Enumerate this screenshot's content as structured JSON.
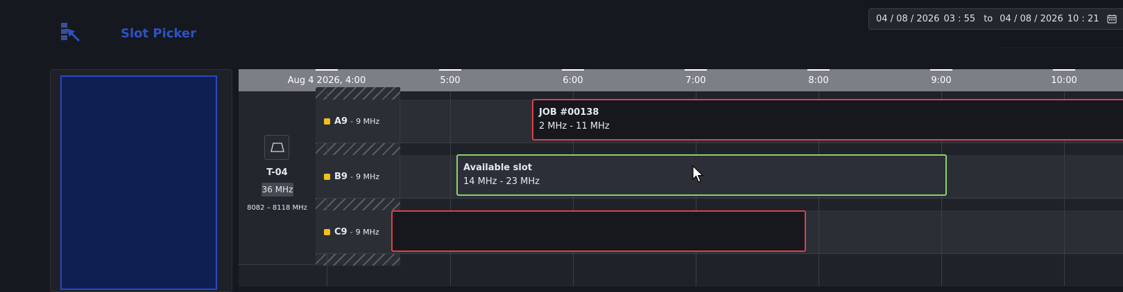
{
  "app": {
    "title": "Slot Picker",
    "logo_icon": "slot-picker-logo-icon"
  },
  "date_range": {
    "from_date": "04 / 08 / 2026",
    "from_time": "03 : 55",
    "separator": "to",
    "to_date": "04 / 08 / 2026",
    "to_time": "10 : 21",
    "icon": "calendar-icon"
  },
  "timeline": {
    "ticks": [
      "Aug 4 2026, 4:00",
      "5:00",
      "6:00",
      "7:00",
      "8:00",
      "9:00",
      "10:00"
    ]
  },
  "track": {
    "icon": "trapezoid-icon",
    "name": "T-04",
    "bandwidth": "36 MHz",
    "freq_range": "8082 – 8118 MHz"
  },
  "channels": [
    {
      "name": "A9",
      "sep": "-",
      "bandwidth": "9 MHz"
    },
    {
      "name": "B9",
      "sep": "-",
      "bandwidth": "9 MHz"
    },
    {
      "name": "C9",
      "sep": "-",
      "bandwidth": "9 MHz"
    }
  ],
  "slots": {
    "job": {
      "title": "JOB #00138",
      "range": "2 MHz - 11 MHz"
    },
    "available": {
      "title": "Available slot",
      "range": "14 MHz - 23 MHz"
    }
  },
  "colors": {
    "accent": "#2d52c2",
    "busy_border": "#e04048",
    "available_border": "#8bd36b",
    "channel_dot": "#f2c01c"
  }
}
